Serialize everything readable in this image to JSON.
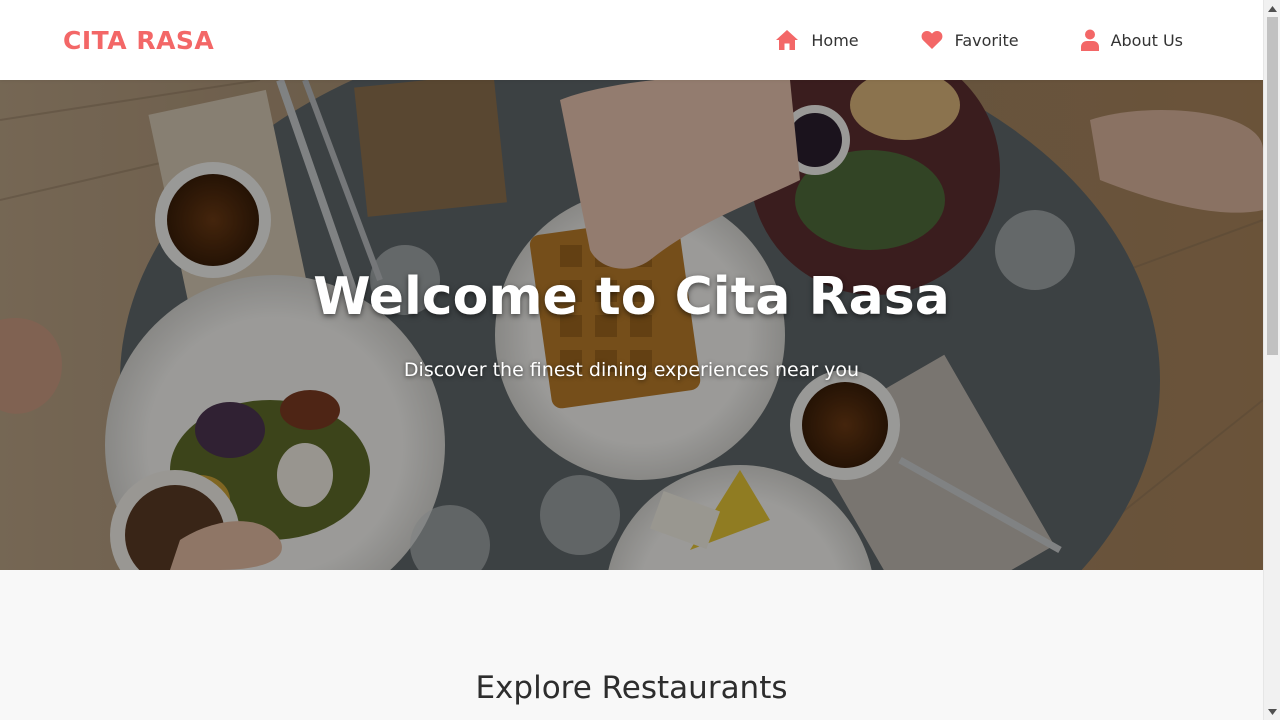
{
  "header": {
    "brand": "CITA RASA",
    "nav": [
      {
        "label": "Home",
        "icon": "home-icon"
      },
      {
        "label": "Favorite",
        "icon": "heart-icon"
      },
      {
        "label": "About Us",
        "icon": "user-icon"
      }
    ]
  },
  "hero": {
    "title": "Welcome to Cita Rasa",
    "subtitle": "Discover the finest dining experiences near you"
  },
  "main": {
    "section_title": "Explore Restaurants"
  },
  "colors": {
    "accent": "#f36767",
    "text": "#333333",
    "background": "#f8f8f8"
  }
}
